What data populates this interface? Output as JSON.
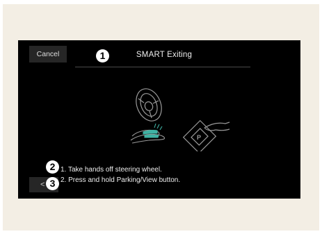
{
  "screen": {
    "cancel_label": "Cancel",
    "title": "SMART Exiting",
    "back_icon_glyph": "<",
    "instructions": [
      "1. Take hands off steering wheel.",
      "2. Press and hold Parking/View button."
    ],
    "illustration_icons": [
      "steering-wheel-icon",
      "hands-icon",
      "parking-view-button-icon"
    ]
  },
  "markers": [
    "1",
    "2",
    "3"
  ],
  "colors": {
    "background": "#f3eee4",
    "screen": "#000000",
    "accent_teal": "#3fb2a4",
    "text": "#eeeeee"
  }
}
